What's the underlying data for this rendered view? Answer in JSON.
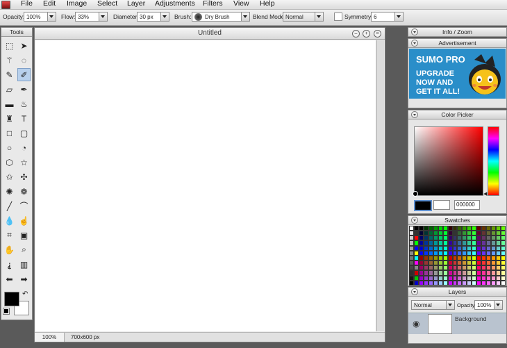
{
  "menu": [
    "File",
    "Edit",
    "Image",
    "Select",
    "Layer",
    "Adjustments",
    "Filters",
    "View",
    "Help"
  ],
  "toolbar": {
    "opacity_label": "Opacity:",
    "opacity_value": "100%",
    "flow_label": "Flow:",
    "flow_value": "33%",
    "diameter_label": "Diameter:",
    "diameter_value": "30 px",
    "brush_label": "Brush:",
    "brush_value": "Dry Brush",
    "blend_label": "Blend Mode:",
    "blend_value": "Normal",
    "symmetry_label": "Symmetry",
    "symmetry_value": "6"
  },
  "tools": {
    "title": "Tools",
    "items": [
      "marquee-icon",
      "move-arrow-icon",
      "magic-wand-icon",
      "lasso-icon",
      "pencil-icon",
      "brush-icon",
      "eraser-icon",
      "pen-icon",
      "gradient-icon",
      "bucket-icon",
      "stamp-icon",
      "text-icon",
      "rectangle-icon",
      "rounded-rect-icon",
      "ellipse-icon",
      "pie-icon",
      "hexagon-icon",
      "star-icon",
      "star-outline-icon",
      "puzzle-icon",
      "burst-icon",
      "flower-icon",
      "line-icon",
      "curve-icon",
      "drop-icon",
      "smudge-icon",
      "crop-icon",
      "transform-icon",
      "hand-icon",
      "zoom-icon",
      "eyedropper-icon",
      "trash-icon",
      "arrow-left-icon",
      "arrow-right-icon"
    ],
    "fg_color": "#000000",
    "bg_color": "#ffffff"
  },
  "document": {
    "title": "Untitled",
    "zoom": "100%",
    "size": "700x600 px"
  },
  "panels": {
    "info": "Info / Zoom",
    "advertisement": "Advertisement",
    "ad_title": "SUMO PRO",
    "ad_lines": [
      "UPGRADE",
      "NOW AND",
      "GET IT ALL!"
    ],
    "color_picker": "Color Picker",
    "hex_value": "000000",
    "swatches": "Swatches",
    "layers": "Layers",
    "layer_mode": "Normal",
    "layer_opacity_label": "Opacity:",
    "layer_opacity": "100%",
    "layer_name": "Background"
  }
}
